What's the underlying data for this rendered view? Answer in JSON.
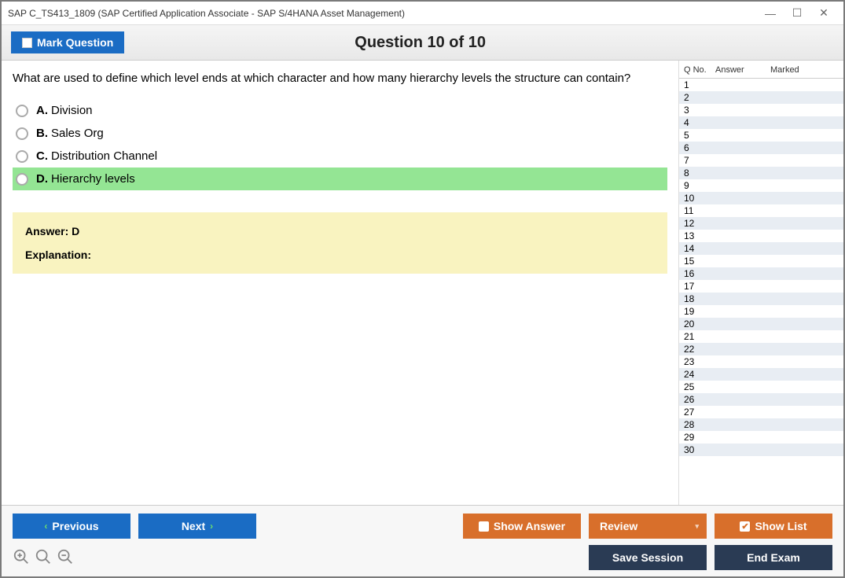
{
  "window": {
    "title": "SAP C_TS413_1809 (SAP Certified Application Associate - SAP S/4HANA Asset Management)"
  },
  "header": {
    "mark_label": "Mark Question",
    "question_counter": "Question 10 of 10"
  },
  "question": {
    "text": "What are used to define which level ends at which character and how many hierarchy levels the structure can contain?",
    "options": [
      {
        "letter": "A.",
        "text": "Division",
        "correct": false
      },
      {
        "letter": "B.",
        "text": "Sales Org",
        "correct": false
      },
      {
        "letter": "C.",
        "text": "Distribution Channel",
        "correct": false
      },
      {
        "letter": "D.",
        "text": "Hierarchy levels",
        "correct": true
      }
    ],
    "answer_label": "Answer: D",
    "explanation_label": "Explanation:"
  },
  "sidebar": {
    "headers": {
      "qno": "Q No.",
      "answer": "Answer",
      "marked": "Marked"
    },
    "rows": [
      1,
      2,
      3,
      4,
      5,
      6,
      7,
      8,
      9,
      10,
      11,
      12,
      13,
      14,
      15,
      16,
      17,
      18,
      19,
      20,
      21,
      22,
      23,
      24,
      25,
      26,
      27,
      28,
      29,
      30
    ]
  },
  "footer": {
    "previous": "Previous",
    "next": "Next",
    "show_answer": "Show Answer",
    "review": "Review",
    "show_list": "Show List",
    "save_session": "Save Session",
    "end_exam": "End Exam"
  }
}
